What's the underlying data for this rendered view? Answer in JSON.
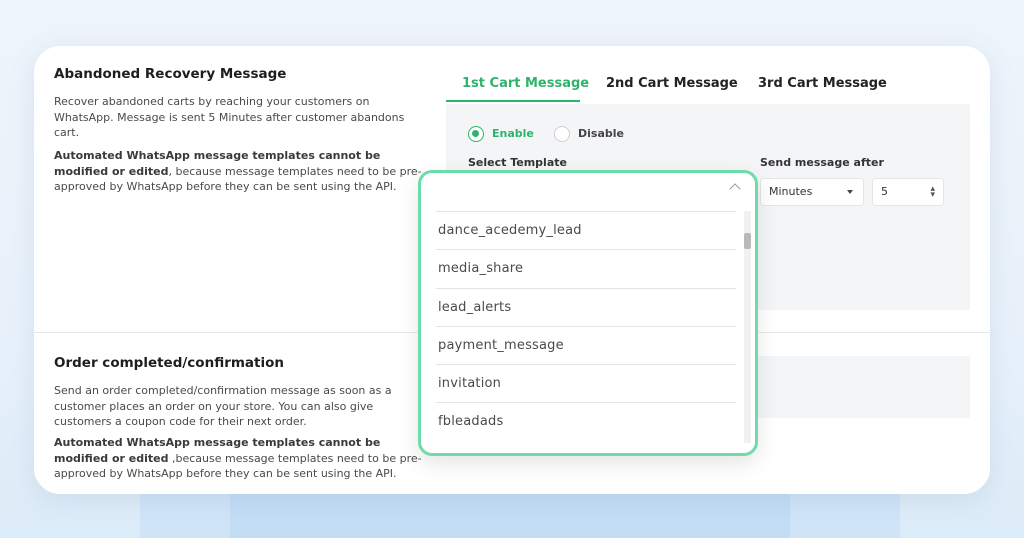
{
  "abandoned": {
    "title": "Abandoned Recovery Message",
    "desc": "Recover abandoned carts by reaching your customers on WhatsApp. Message is sent 5 Minutes after customer abandons cart.",
    "note_bold": "Automated WhatsApp message templates cannot be modified or edited",
    "note_rest": ", because message templates need to be pre-approved by WhatsApp before they can be sent using the API."
  },
  "tabs": [
    {
      "label": "1st Cart Message",
      "active": true
    },
    {
      "label": "2nd Cart Message",
      "active": false
    },
    {
      "label": "3rd Cart Message",
      "active": false
    }
  ],
  "form": {
    "enable_label": "Enable",
    "disable_label": "Disable",
    "enabled": true,
    "select_template_label": "Select Template",
    "send_after_label": "Send message after",
    "unit_value": "Minutes",
    "amount_value": "5"
  },
  "dropdown": {
    "options": [
      "dance_acedemy_lead",
      "media_share",
      "lead_alerts",
      "payment_message",
      "invitation",
      "fbleadads"
    ]
  },
  "order": {
    "title": "Order completed/confirmation",
    "desc": "Send an order completed/confirmation message as soon as a customer places an order on your store. You can also give customers a coupon code for their next order.",
    "note_bold": "Automated WhatsApp message templates cannot be modified or edited",
    "note_rest": " ,because message templates need to be pre-approved by WhatsApp before they can be sent using the API."
  },
  "colors": {
    "accent": "#2fb36a",
    "highlight_border": "#6ddcaa"
  }
}
